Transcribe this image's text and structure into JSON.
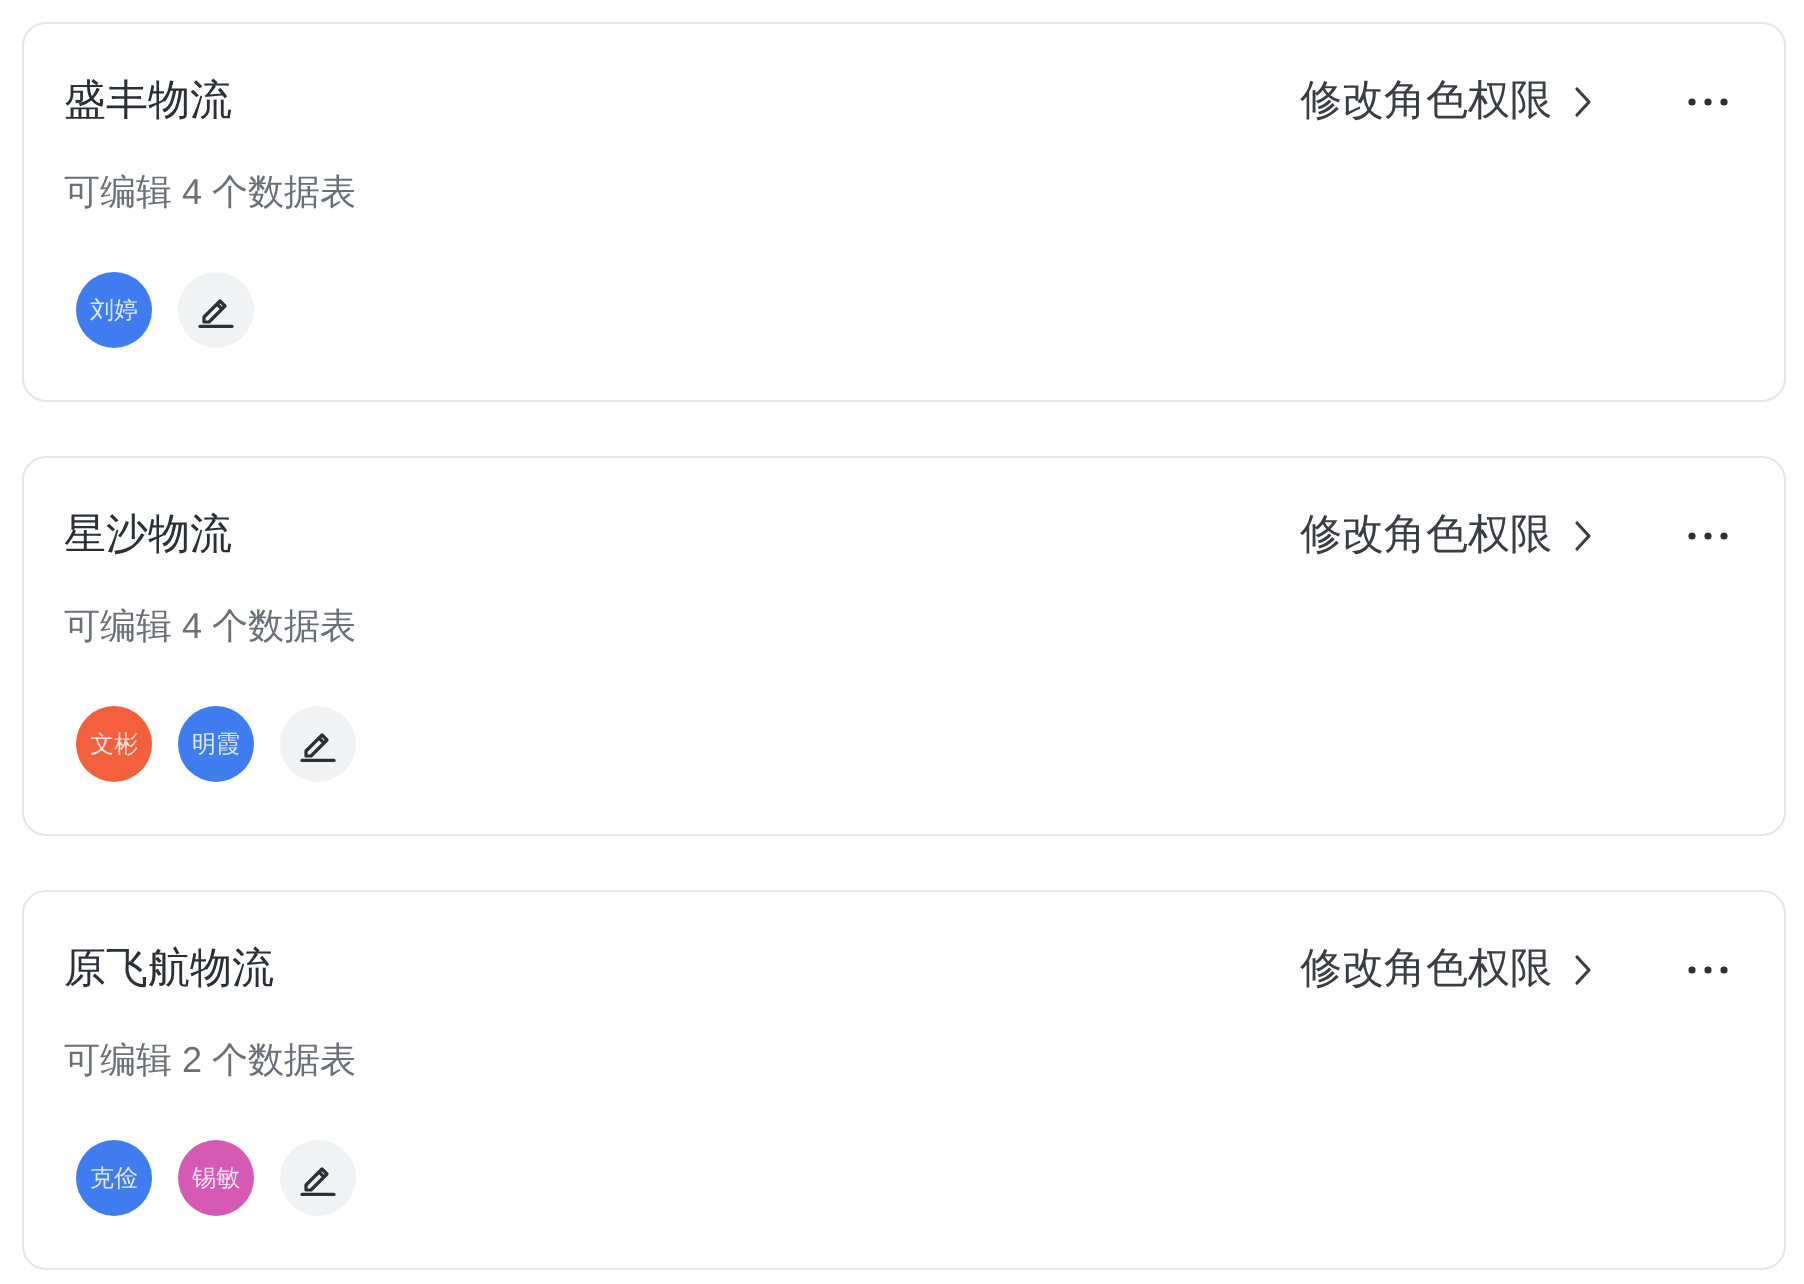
{
  "cards": [
    {
      "title": "盛丰物流",
      "subtitle": "可编辑 4 个数据表",
      "action": "修改角色权限",
      "members": [
        {
          "name": "刘婷",
          "color": "#3f7cf0"
        }
      ]
    },
    {
      "title": "星沙物流",
      "subtitle": "可编辑 4 个数据表",
      "action": "修改角色权限",
      "members": [
        {
          "name": "文彬",
          "color": "#f5603c"
        },
        {
          "name": "明霞",
          "color": "#3f7cf0"
        }
      ]
    },
    {
      "title": "原飞航物流",
      "subtitle": "可编辑 2 个数据表",
      "action": "修改角色权限",
      "members": [
        {
          "name": "克俭",
          "color": "#3f7cf0"
        },
        {
          "name": "锡敏",
          "color": "#d659b4"
        }
      ]
    }
  ]
}
